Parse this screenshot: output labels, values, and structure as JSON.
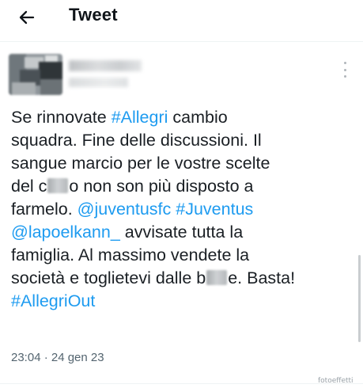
{
  "header": {
    "title": "Tweet",
    "back_icon": "arrow-left-icon"
  },
  "tweet": {
    "more_icon": "more-vertical-icon",
    "lines": [
      [
        {
          "text": "Se rinnovate ",
          "type": "text"
        },
        {
          "text": "#Allegri",
          "type": "tag"
        },
        {
          "text": " cambio",
          "type": "text"
        }
      ],
      [
        {
          "text": "squadra. Fine delle discussioni. Il",
          "type": "text"
        }
      ],
      [
        {
          "text": "sangue marcio per le vostre scelte",
          "type": "text"
        }
      ],
      [
        {
          "text": "del c",
          "type": "text"
        },
        {
          "text": "",
          "type": "censor",
          "variant": "1"
        },
        {
          "text": "o non son più disposto a",
          "type": "text"
        }
      ],
      [
        {
          "text": "farmelo. ",
          "type": "text"
        },
        {
          "text": "@juventusfc",
          "type": "tag"
        },
        {
          "text": " ",
          "type": "text"
        },
        {
          "text": "#Juventus",
          "type": "tag"
        }
      ],
      [
        {
          "text": "@lapoelkann_",
          "type": "tag"
        },
        {
          "text": " avvisate tutta la",
          "type": "text"
        }
      ],
      [
        {
          "text": "famiglia. Al massimo vendete la",
          "type": "text"
        }
      ],
      [
        {
          "text": "società e toglietevi dalle b",
          "type": "text"
        },
        {
          "text": "",
          "type": "censor",
          "variant": "2"
        },
        {
          "text": "e. Basta!",
          "type": "text"
        }
      ],
      [
        {
          "text": "#AllegriOut",
          "type": "tag"
        }
      ]
    ],
    "timestamp": "23:04 · 24 gen 23"
  },
  "watermark": {
    "text": "fotoeffetti"
  },
  "colors": {
    "link": "#1d9bf0",
    "text": "#1a1f24",
    "meta": "#53646f",
    "divider": "#eff3f4"
  }
}
